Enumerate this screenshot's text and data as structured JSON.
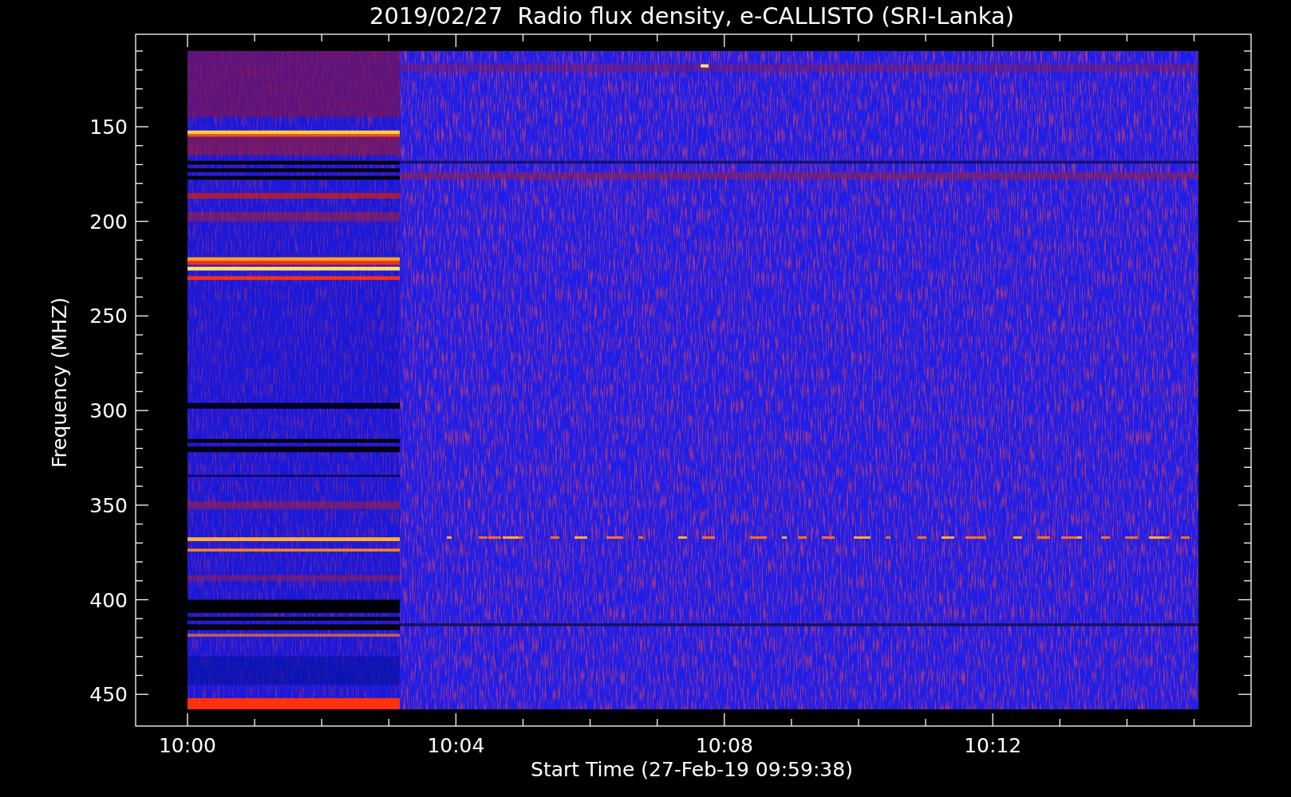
{
  "title": "2019/02/27  Radio flux density, e-CALLISTO (SRI-Lanka)",
  "y_axis": {
    "label": "Frequency (MHZ)",
    "ticks": [
      "150",
      "200",
      "250",
      "300",
      "350",
      "400",
      "450"
    ]
  },
  "x_axis": {
    "label": "Start Time (27-Feb-19 09:59:38)",
    "ticks": [
      "10:00",
      "10:04",
      "10:08",
      "10:12"
    ]
  }
}
